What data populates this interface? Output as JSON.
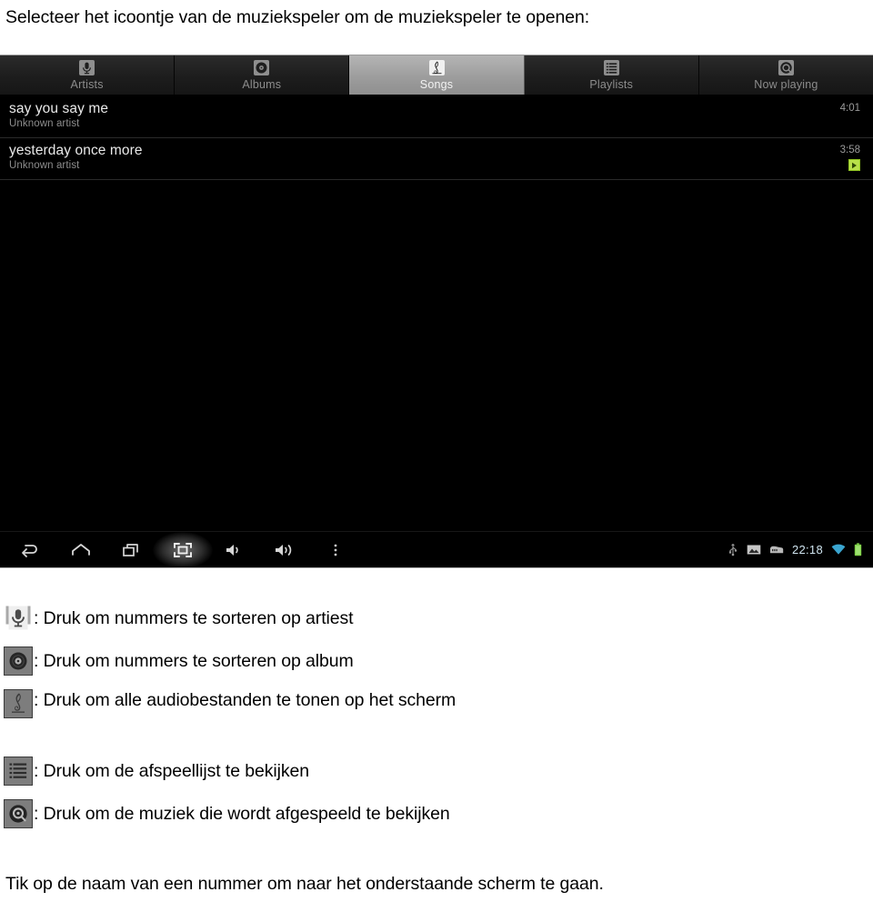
{
  "document": {
    "heading": "Selecteer het icoontje van de muziekspeler om de muziekspeler te openen:",
    "closing_line": "Tik op de naam van een nummer om naar het onderstaande scherm te gaan."
  },
  "screenshot": {
    "tabs": [
      {
        "label": "Artists",
        "icon": "microphone-icon",
        "selected": false
      },
      {
        "label": "Albums",
        "icon": "vinyl-record-icon",
        "selected": false
      },
      {
        "label": "Songs",
        "icon": "treble-clef-icon",
        "selected": true
      },
      {
        "label": "Playlists",
        "icon": "list-icon",
        "selected": false
      },
      {
        "label": "Now playing",
        "icon": "headphone-disc-icon",
        "selected": false
      }
    ],
    "songs": [
      {
        "title": "say you say me",
        "artist": "Unknown artist",
        "duration": "4:01",
        "now_playing": false
      },
      {
        "title": "yesterday once more",
        "artist": "Unknown artist",
        "duration": "3:58",
        "now_playing": true
      }
    ],
    "navbar": [
      {
        "name": "back-icon"
      },
      {
        "name": "home-icon"
      },
      {
        "name": "recents-icon"
      },
      {
        "name": "screenshot-icon"
      },
      {
        "name": "volume-down-icon"
      },
      {
        "name": "volume-up-icon"
      },
      {
        "name": "overflow-menu-icon"
      }
    ],
    "statusbar": {
      "usb_icon": "usb-icon",
      "screenshot_icon": "image-capture-icon",
      "sdcard_icon": "sdcard-icon",
      "clock": "22:18",
      "wifi_icon": "wifi-icon",
      "battery_icon": "battery-icon"
    },
    "colors": {
      "accent_green": "#b9e14a",
      "clock_blue": "#cfe4ef",
      "selected_tab": "#9d9d9d"
    }
  },
  "legend": [
    {
      "icon": "microphone-icon",
      "text": ": Druk om nummers te sorteren op artiest"
    },
    {
      "icon": "vinyl-record-icon",
      "text": ": Druk om nummers te sorteren op album"
    },
    {
      "icon": "treble-clef-icon",
      "text": ": Druk om alle audiobestanden te tonen op het scherm"
    },
    {
      "icon": "list-icon",
      "text": ": Druk om de afspeellijst te bekijken"
    },
    {
      "icon": "headphone-disc-icon",
      "text": ": Druk om de muziek die wordt afgespeeld te bekijken"
    }
  ]
}
